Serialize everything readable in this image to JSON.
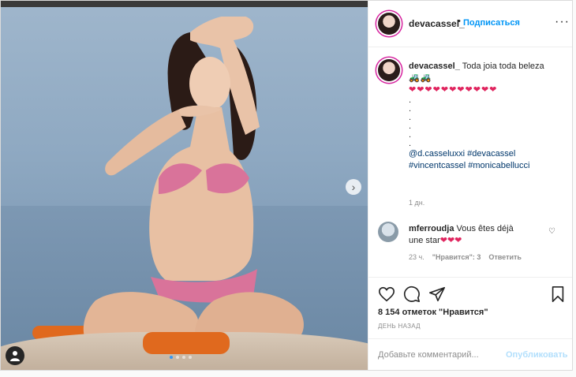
{
  "header": {
    "username": "devacassel_",
    "separator": "•",
    "follow_label": "Подписаться",
    "more_label": "···"
  },
  "caption": {
    "username": "devacassel_",
    "text": "Toda joia toda beleza",
    "emoji_blue": "🚜🚜",
    "emoji_hearts": "❤❤❤❤❤❤❤❤❤❤❤",
    "periods": [
      ".",
      ".",
      ".",
      ".",
      ".",
      "."
    ],
    "tags_line1_a": "@d.casseluxxi",
    "tags_line1_b": "#devacassel",
    "tags_line2_a": "#vincentcassel",
    "tags_line2_b": "#monicabellucci",
    "time": "1 дн."
  },
  "comment": {
    "username": "mferroudja",
    "text": "Vous êtes déjà une star",
    "hearts": "❤❤❤",
    "time": "23 ч.",
    "likes": "\"Нравится\": 3",
    "reply": "Ответить"
  },
  "media": {
    "next_label": "›",
    "slides": 4,
    "active_slide": 1
  },
  "actions": {
    "likes_text": "8 154 отметок \"Нравится\"",
    "date_text": "ДЕНЬ НАЗАД"
  },
  "add_comment": {
    "placeholder": "Добавьте комментарий...",
    "publish_label": "Опубликовать"
  },
  "colors": {
    "accent": "#0095f6",
    "heart": "#e0245e",
    "muted": "#8e8e8e"
  }
}
